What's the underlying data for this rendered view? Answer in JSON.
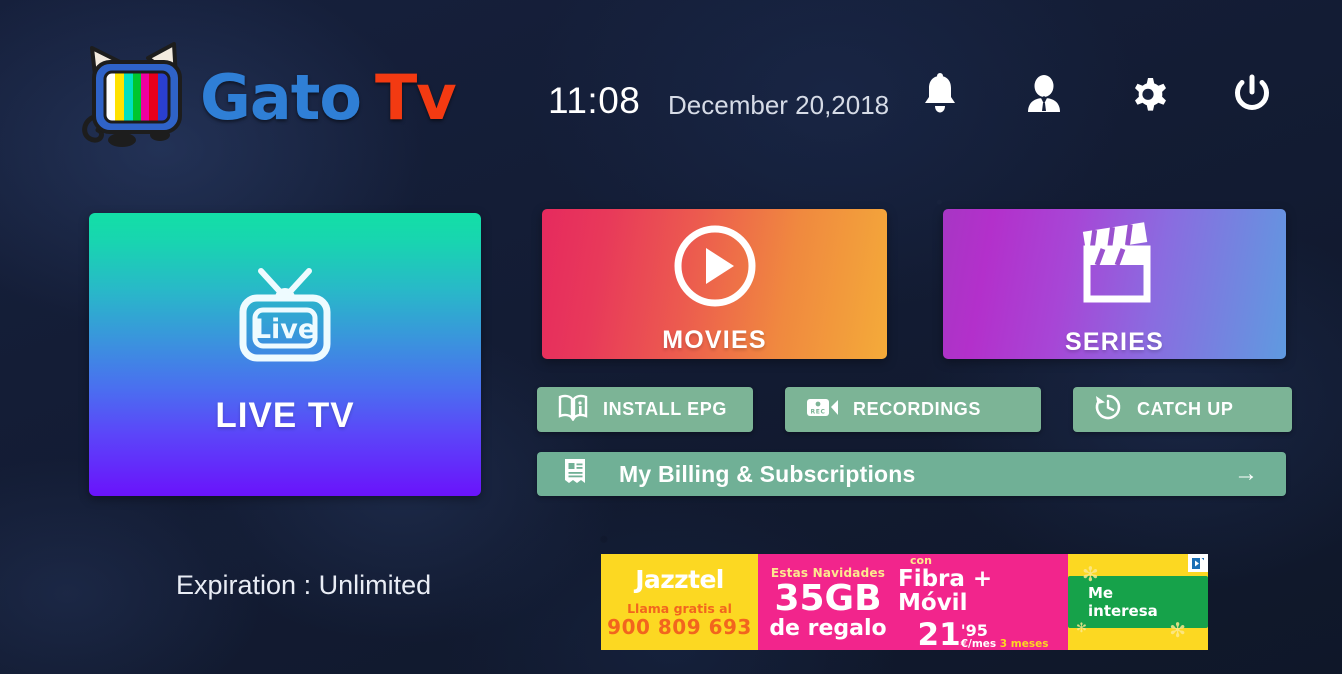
{
  "app": {
    "logo_gato": "Gato",
    "logo_tv": "Tv",
    "logo_icon": "cat-tv-logo-icon"
  },
  "header": {
    "time": "11:08",
    "date": "December 20,2018",
    "icons": [
      {
        "name": "bell-icon",
        "label": "Notifications"
      },
      {
        "name": "user-icon",
        "label": "Account"
      },
      {
        "name": "gear-icon",
        "label": "Settings"
      },
      {
        "name": "power-icon",
        "label": "Power"
      }
    ]
  },
  "cards": {
    "live_tv": {
      "label": "LIVE TV",
      "icon": "tv-live-icon",
      "icon_text": "Live",
      "gradient_from": "#13dfa6",
      "gradient_to": "#6a13fb"
    },
    "movies": {
      "label": "MOVIES",
      "icon": "play-circle-icon",
      "gradient_from": "#e62a5e",
      "gradient_to": "#f4ab39"
    },
    "series": {
      "label": "SERIES",
      "icon": "clapperboard-icon",
      "gradient_from": "#a736c4",
      "gradient_to": "#5f9ae0"
    }
  },
  "buttons": {
    "accent_color": "#7cb496",
    "install_epg": {
      "label": "INSTALL EPG",
      "icon": "book-info-icon"
    },
    "recordings": {
      "label": "RECORDINGS",
      "icon": "video-rec-icon"
    },
    "catch_up": {
      "label": "CATCH UP",
      "icon": "clock-rewind-icon"
    },
    "billing": {
      "label": "My Billing & Subscriptions",
      "icon": "receipt-icon",
      "arrow": "→"
    }
  },
  "status": {
    "expiration": "Expiration : Unlimited"
  },
  "ad": {
    "brand": "Jazztel",
    "call_text": "Llama gratis al",
    "phone": "900 809 693",
    "christmas": "Estas Navidades",
    "data_amount": "35GB",
    "gift_text": "de regalo",
    "con": "con",
    "product": "Fibra + Móvil",
    "price": "21",
    "price_cents": "'95",
    "per_month": "€/mes",
    "months": "3 meses",
    "cta": "Me interesa",
    "adchoices": "adchoices-icon"
  }
}
